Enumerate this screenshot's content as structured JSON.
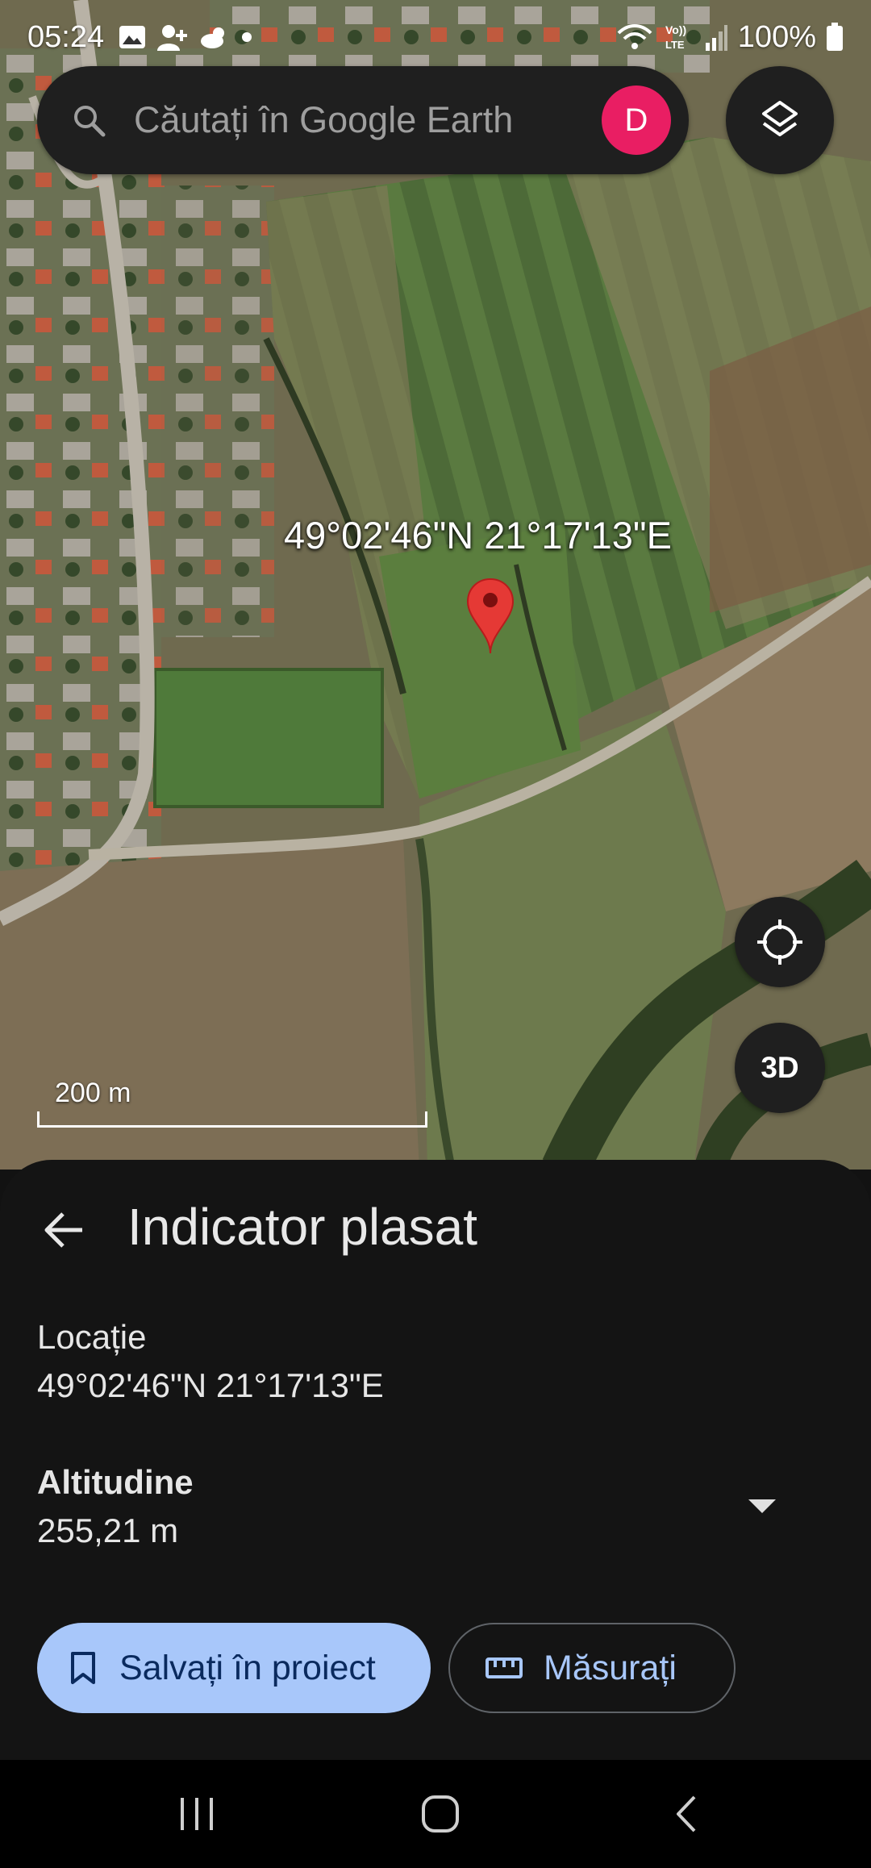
{
  "status_bar": {
    "time": "05:24",
    "battery": "100%",
    "network": "LTE"
  },
  "search": {
    "placeholder": "Căutați în Google Earth",
    "avatar_letter": "D",
    "avatar_color": "#e91e63"
  },
  "map": {
    "pin_label": "49°02'46\"N 21°17'13\"E",
    "scale_label": "200 m",
    "three_d_label": "3D"
  },
  "sheet": {
    "title": "Indicator plasat",
    "location_label": "Locație",
    "location_value": "49°02'46\"N 21°17'13\"E",
    "altitude_label": "Altitudine",
    "altitude_value": "255,21 m",
    "save_button": "Salvați în proiect",
    "measure_button": "Măsurați"
  },
  "colors": {
    "accent": "#a8c7fa",
    "pin": "#e53935",
    "sheet_bg": "#141414"
  }
}
